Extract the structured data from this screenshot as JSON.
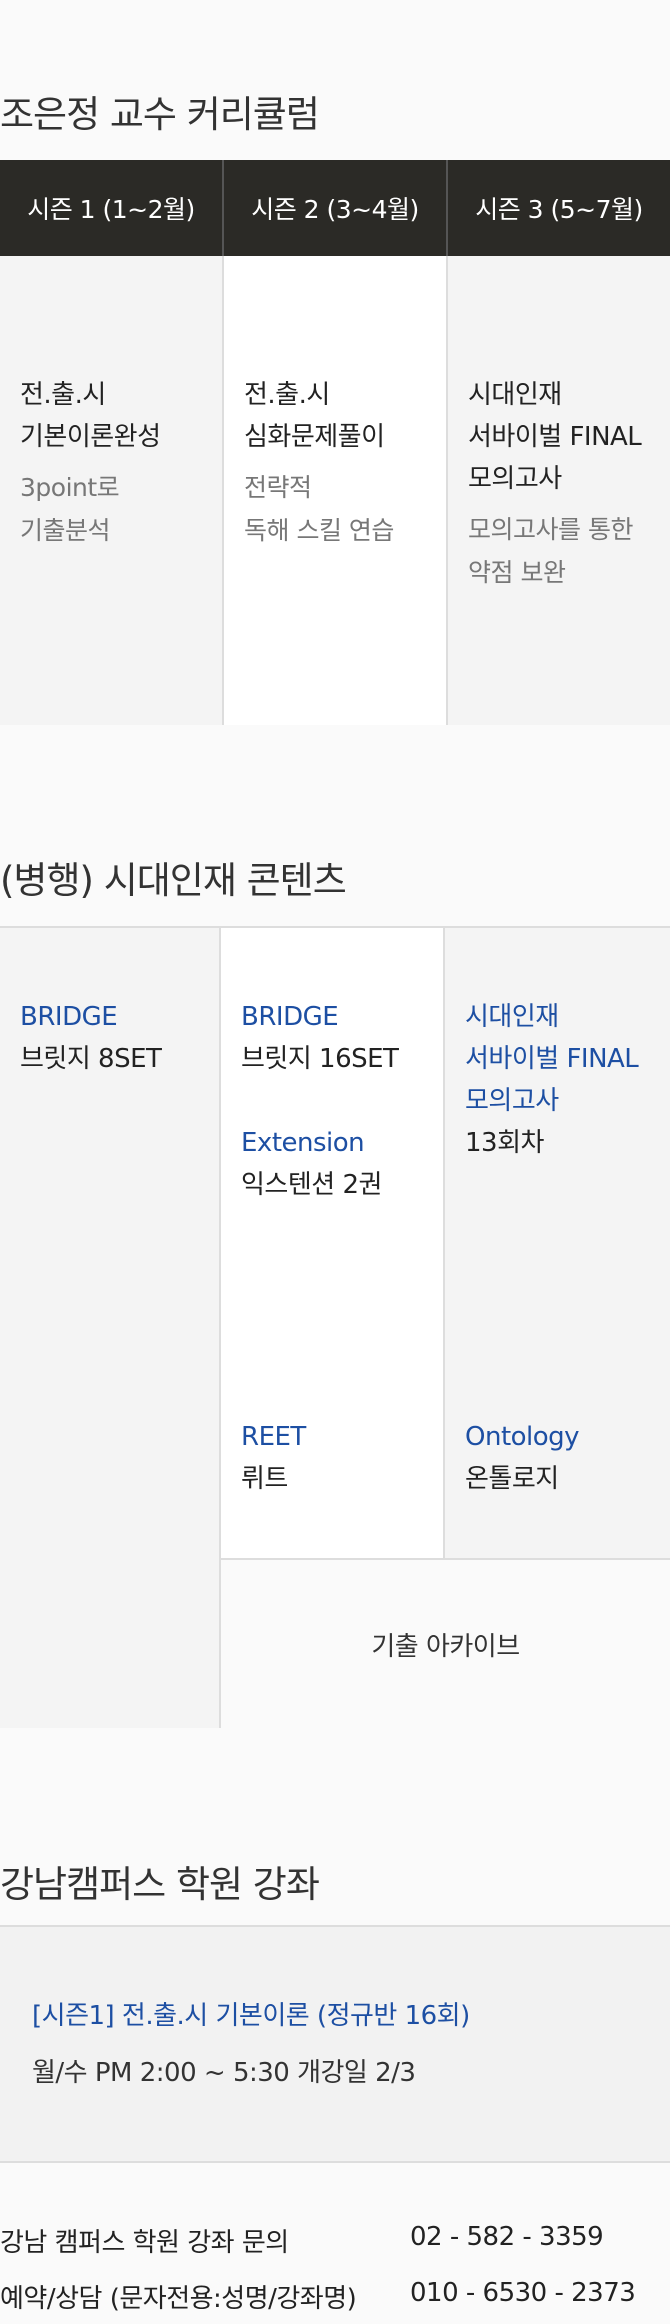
{
  "curriculum": {
    "title": "조은정 교수 커리큘럼",
    "seasons": [
      {
        "header": "시즌 1 (1~2월)",
        "main_1": "전.출.시",
        "main_2": "기본이론완성",
        "sub_1": "3point로",
        "sub_2": "기출분석"
      },
      {
        "header": "시즌 2 (3~4월)",
        "main_1": "전.출.시",
        "main_2": "심화문제풀이",
        "sub_1": "전략적",
        "sub_2": "독해 스킬 연습"
      },
      {
        "header": "시즌 3 (5~7월)",
        "main_1": "시대인재",
        "main_2": "서바이벌 FINAL",
        "main_3": "모의고사",
        "sub_1": "모의고사를 통한",
        "sub_2": "약점 보완"
      }
    ]
  },
  "contents": {
    "title": "(병행) 시대인재 콘텐츠",
    "col1": {
      "name": "BRIDGE",
      "desc": "브릿지 8SET"
    },
    "col2": {
      "name1": "BRIDGE",
      "desc1": "브릿지 16SET",
      "name2": "Extension",
      "desc2": "익스텐션 2권",
      "name3": "REET",
      "desc3": "뤼트"
    },
    "col3": {
      "name1_a": "시대인재",
      "name1_b": "서바이벌 FINAL",
      "name1_c": "모의고사",
      "desc1": "13회차",
      "name2": "Ontology",
      "desc2": "온톨로지"
    },
    "archive": "기출 아카이브"
  },
  "academy": {
    "title": "강남캠퍼스 학원 강좌",
    "course": "[시즌1] 전.출.시 기본이론 (정규반 16회)",
    "schedule": "월/수 PM 2:00 ~ 5:30 개강일 2/3",
    "contacts": [
      {
        "label": "강남 캠퍼스 학원 강좌 문의",
        "number": "02 - 582 - 3359"
      },
      {
        "label": "예약/상담 (문자전용:성명/강좌명)",
        "number": "010 - 6530 - 2373"
      }
    ]
  },
  "colors": {
    "header_bg": "#2b2a26",
    "accent_blue": "#1d4fa3",
    "muted_text": "#777777"
  }
}
